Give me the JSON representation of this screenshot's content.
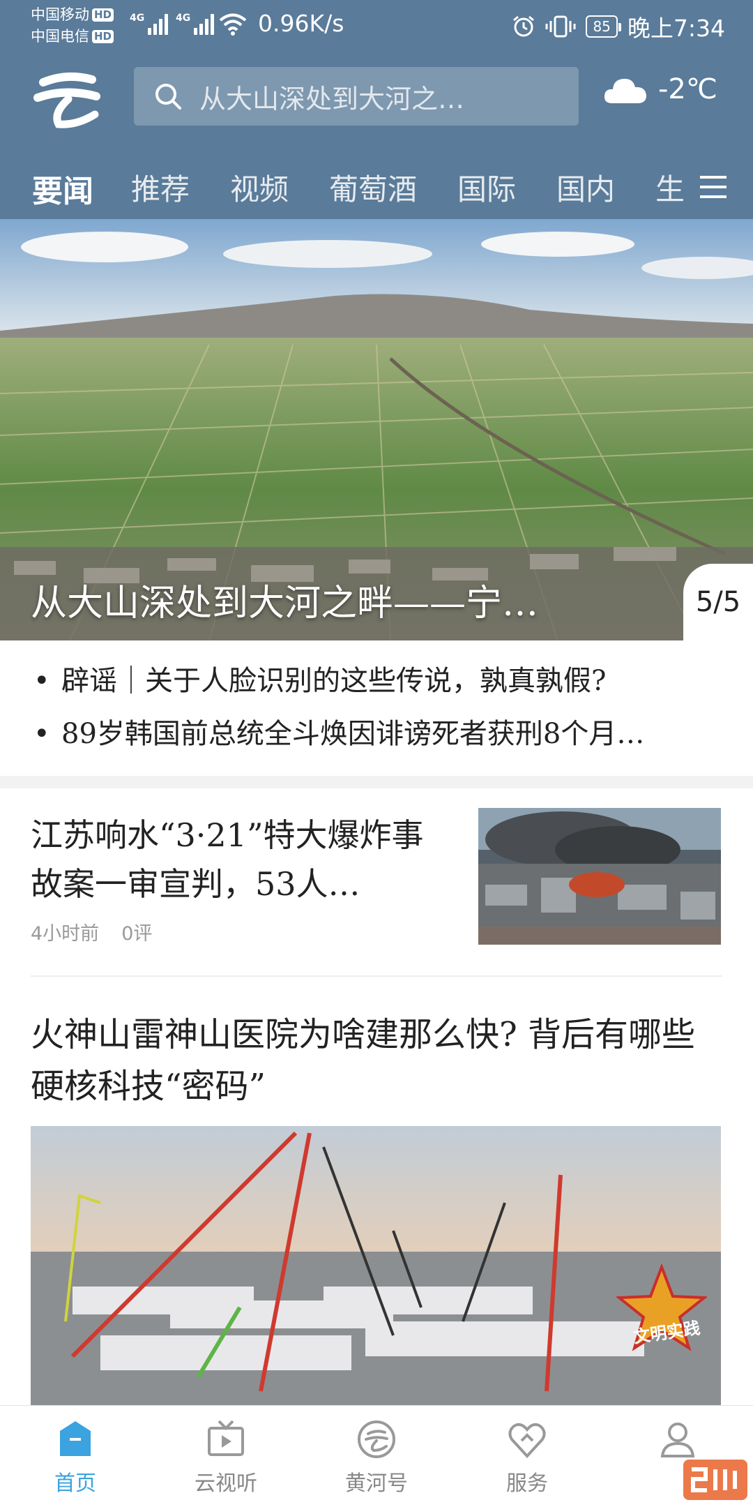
{
  "status_bar": {
    "carrier1": "中国移动",
    "carrier2": "中国电信",
    "hd": "HD",
    "net_gen": "4G",
    "speed": "0.96K/s",
    "battery": "85",
    "time": "晚上7:34"
  },
  "header": {
    "search_placeholder": "从大山深处到大河之…",
    "temperature": "-2℃",
    "weather_icon": "cloud-icon"
  },
  "tabs": [
    {
      "label": "要闻",
      "active": true
    },
    {
      "label": "推荐"
    },
    {
      "label": "视频"
    },
    {
      "label": "葡萄酒"
    },
    {
      "label": "国际"
    },
    {
      "label": "国内"
    },
    {
      "label": "生"
    }
  ],
  "hero": {
    "caption": "从大山深处到大河之畔——宁…",
    "counter": "5/5"
  },
  "bullets": [
    "辟谣｜关于人脸识别的这些传说，孰真孰假?",
    "89岁韩国前总统全斗焕因诽谤死者获刑8个月…"
  ],
  "article1": {
    "title": "江苏响水“3·21”特大爆炸事故案一审宣判，53人…",
    "time": "4小时前",
    "comments": "0评"
  },
  "article2": {
    "title": "火神山雷神山医院为啥建那么快? 背后有哪些硬核科技“密码”",
    "badge": "文明实践"
  },
  "bottom_nav": [
    {
      "label": "首页",
      "icon": "home-icon",
      "active": true
    },
    {
      "label": "云视听",
      "icon": "tv-icon"
    },
    {
      "label": "黄河号",
      "icon": "yellow-river-icon"
    },
    {
      "label": "服务",
      "icon": "heart-service-icon"
    },
    {
      "label": "",
      "icon": "profile-icon"
    }
  ],
  "colors": {
    "header_bg": "#5a7b99",
    "active_nav": "#3aa3e0"
  }
}
